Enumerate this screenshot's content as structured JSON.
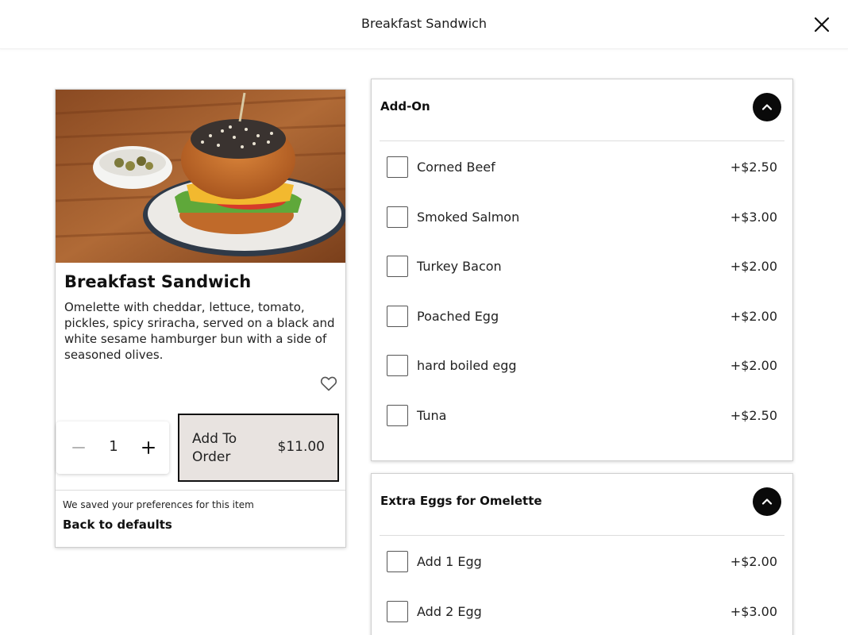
{
  "header": {
    "title": "Breakfast Sandwich",
    "close_icon": "close-icon"
  },
  "item": {
    "image_alt": "breakfast sandwich photo",
    "title": "Breakfast Sandwich",
    "description": "Omelette with cheddar, lettuce, tomato, pickles, spicy sriracha, served on a black and white sesame hamburger bun with a side of seasoned olives.",
    "favorite_icon": "heart-icon",
    "quantity": "1",
    "add_button": {
      "label": "Add To Order",
      "price": "$11.00"
    },
    "preferences_note": "We saved your preferences for this item",
    "back_to_defaults": "Back to defaults"
  },
  "groups": [
    {
      "title": "Add-On",
      "collapse_icon": "chevron-up-icon",
      "options": [
        {
          "label": "Corned Beef",
          "price": "+$2.50"
        },
        {
          "label": "Smoked Salmon",
          "price": "+$3.00"
        },
        {
          "label": "Turkey Bacon",
          "price": "+$2.00"
        },
        {
          "label": "Poached Egg",
          "price": "+$2.00"
        },
        {
          "label": "hard boiled egg",
          "price": "+$2.00"
        },
        {
          "label": "Tuna",
          "price": "+$2.50"
        }
      ]
    },
    {
      "title": "Extra Eggs for Omelette",
      "collapse_icon": "chevron-up-icon",
      "options": [
        {
          "label": "Add 1 Egg",
          "price": "+$2.00"
        },
        {
          "label": "Add 2 Egg",
          "price": "+$3.00"
        }
      ]
    }
  ],
  "colors": {
    "add_button_bg": "#e8e3e0",
    "accent_black": "#0a0a0a"
  }
}
